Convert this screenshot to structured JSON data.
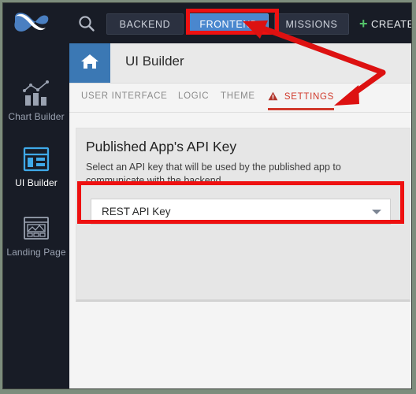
{
  "topbar": {
    "logo_name": "backendless-infinity-logo",
    "search_icon": "search-icon",
    "nav": [
      {
        "id": "backend",
        "label": "BACKEND",
        "active": false
      },
      {
        "id": "frontend",
        "label": "FRONTEND",
        "active": true
      },
      {
        "id": "missions",
        "label": "MISSIONS",
        "active": false
      }
    ],
    "create": {
      "plus": "+",
      "label": "CREATE",
      "plus_color": "#54c46a"
    },
    "bg_color": "#181c26",
    "active_nav_color": "#4a87ce"
  },
  "sidebar": {
    "items": [
      {
        "id": "chart-builder",
        "label": "Chart Builder",
        "icon": "chart-builder-icon",
        "active": false
      },
      {
        "id": "ui-builder",
        "label": "UI Builder",
        "icon": "ui-builder-icon",
        "active": true
      },
      {
        "id": "landing-page",
        "label": "Landing Page",
        "icon": "landing-page-icon",
        "active": false
      }
    ]
  },
  "page_header": {
    "home_icon": "home-icon",
    "title": "UI Builder",
    "home_tab_color": "#3b78b4"
  },
  "tabs": [
    {
      "id": "user-interface",
      "label": "USER INTERFACE",
      "active": false
    },
    {
      "id": "logic",
      "label": "LOGIC",
      "active": false
    },
    {
      "id": "theme",
      "label": "THEME",
      "active": false
    },
    {
      "id": "settings",
      "label": "SETTINGS",
      "active": true,
      "icon": "warning-triangle-icon",
      "color": "#d0392b"
    }
  ],
  "card": {
    "heading": "Published App's API Key",
    "description": "Select an API key that will be used by the published app to communicate with the backend.",
    "api_key_select": {
      "value": "REST API Key",
      "chevron": "chevron-down-icon"
    }
  },
  "annotations": {
    "highlight_color": "#ee1111",
    "boxes": [
      {
        "target": "frontend-nav-button"
      },
      {
        "target": "api-key-dropdown"
      }
    ],
    "arrows": [
      {
        "from": "origin",
        "to": "frontend-nav-button"
      },
      {
        "from": "origin",
        "to": "settings-tab"
      }
    ]
  }
}
